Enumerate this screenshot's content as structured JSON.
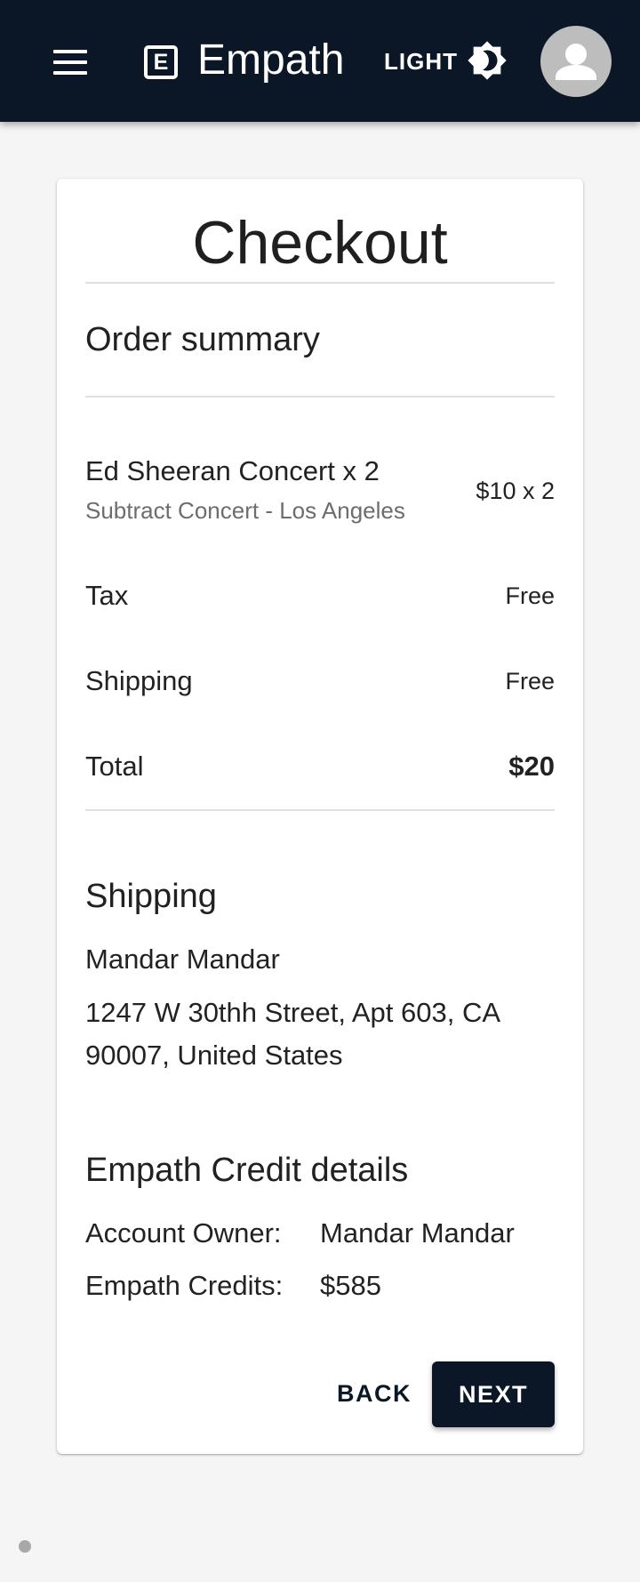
{
  "header": {
    "brand": "Empath",
    "logo_letter": "E",
    "theme_label": "LIGHT",
    "icons": {
      "menu": "menu-icon",
      "theme": "brightness-icon",
      "avatar": "account-circle-icon"
    },
    "background_color": "#0b1727"
  },
  "checkout": {
    "title": "Checkout",
    "order_summary": {
      "heading": "Order summary",
      "item": {
        "name": "Ed Sheeran Concert x 2",
        "description": "Subtract Concert - Los Angeles",
        "price": "$10 x 2"
      },
      "tax": {
        "label": "Tax",
        "value": "Free"
      },
      "shipping": {
        "label": "Shipping",
        "value": "Free"
      },
      "total": {
        "label": "Total",
        "value": "$20"
      }
    },
    "shipping": {
      "heading": "Shipping",
      "name": "Mandar Mandar",
      "address_line1": "1247 W 30thh Street, Apt 603, CA",
      "address_line2": "90007, United States"
    },
    "credit": {
      "heading": "Empath Credit details",
      "owner_label": "Account Owner:",
      "owner_value": "Mandar Mandar",
      "credits_label": "Empath Credits:",
      "credits_value": "$585"
    },
    "actions": {
      "back": "BACK",
      "next": "NEXT"
    }
  }
}
